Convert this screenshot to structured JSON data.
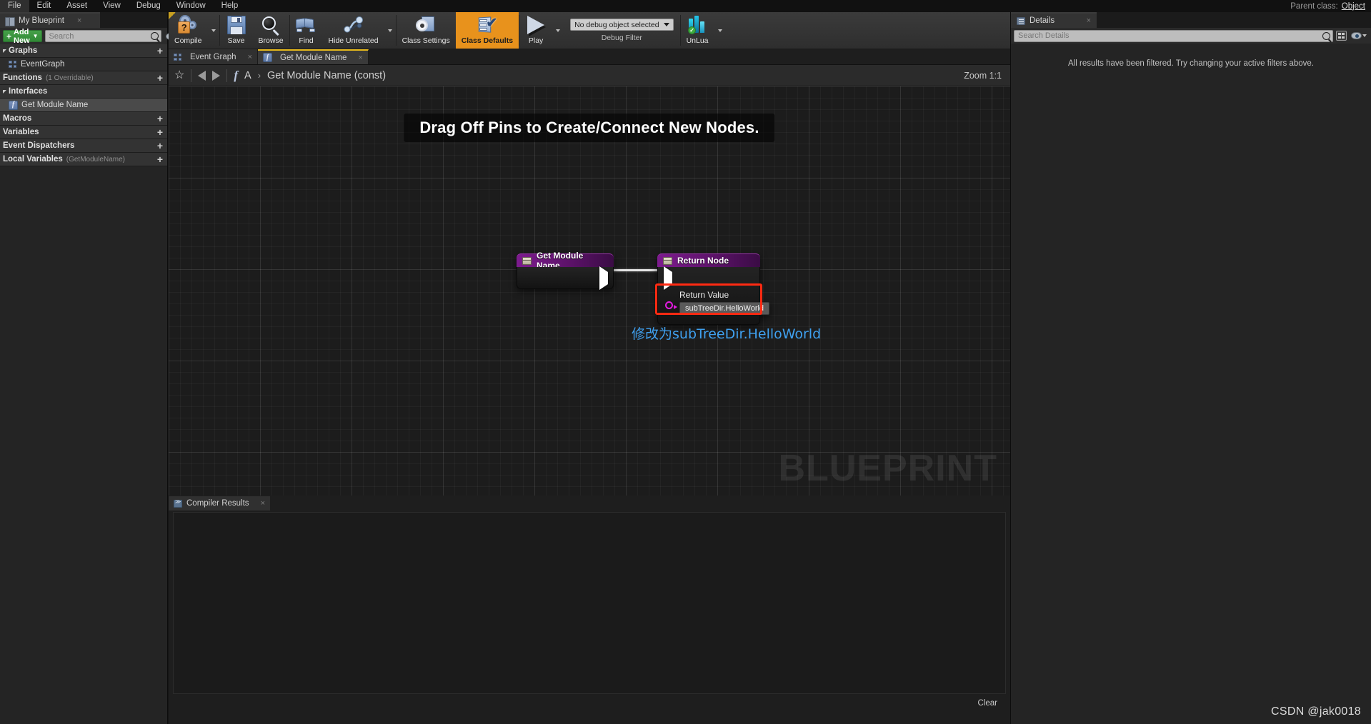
{
  "menubar": {
    "items": [
      "File",
      "Edit",
      "Asset",
      "View",
      "Debug",
      "Window",
      "Help"
    ],
    "parent_class_label": "Parent class:",
    "parent_class_value": "Object"
  },
  "left_panel": {
    "tab_label": "My Blueprint",
    "tab_close": "×",
    "add_new_label": "Add New",
    "add_new_plus": "+",
    "search_placeholder": "Search",
    "search_value": "",
    "tree": [
      {
        "label": "Graphs",
        "sub": "",
        "type": "category",
        "expandable": true,
        "plus": true
      },
      {
        "label": "EventGraph",
        "sub": "",
        "type": "graph-item",
        "expandable": false,
        "plus": false
      },
      {
        "label": "Functions",
        "sub": "(1 Overridable)",
        "type": "category",
        "expandable": false,
        "plus": true
      },
      {
        "label": "Interfaces",
        "sub": "",
        "type": "category",
        "expandable": true,
        "plus": false
      },
      {
        "label": "Get Module Name",
        "sub": "",
        "type": "function-item",
        "expandable": false,
        "plus": false
      },
      {
        "label": "Macros",
        "sub": "",
        "type": "category",
        "expandable": false,
        "plus": true
      },
      {
        "label": "Variables",
        "sub": "",
        "type": "category",
        "expandable": false,
        "plus": true
      },
      {
        "label": "Event Dispatchers",
        "sub": "",
        "type": "category",
        "expandable": false,
        "plus": true
      },
      {
        "label": "Local Variables",
        "sub": "(GetModuleName)",
        "type": "category",
        "expandable": false,
        "plus": true
      }
    ]
  },
  "toolbar": {
    "compile": "Compile",
    "compile_glyph": "?",
    "save": "Save",
    "browse": "Browse",
    "find": "Find",
    "hide_unrelated": "Hide Unrelated",
    "class_settings": "Class Settings",
    "class_defaults": "Class Defaults",
    "class_defaults_active_color": "#e8921c",
    "play": "Play",
    "debug_object": "No debug object selected",
    "debug_filter_label": "Debug Filter",
    "unlua": "UnLua",
    "unlua_check": "✓"
  },
  "graph_tabs": [
    {
      "label": "Event Graph",
      "icon": "event-graph-icon",
      "active": false,
      "close": "×"
    },
    {
      "label": "Get Module Name",
      "icon": "function-icon",
      "active": true,
      "close": "×"
    }
  ],
  "breadcrumb": {
    "star": "☆",
    "function_glyph": "f",
    "root": "A",
    "separator": "›",
    "current": "Get Module Name (const)",
    "zoom": "Zoom 1:1"
  },
  "graph": {
    "hint": "Drag Off Pins to Create/Connect New Nodes.",
    "watermark": "BLUEPRINT",
    "annotation": "修改为subTreeDir.HelloWorld",
    "annotation_color": "#3fa0ef",
    "highlight_color": "#ff2a12",
    "nodes": [
      {
        "title": "Get Module Name",
        "type": "function-entry"
      },
      {
        "title": "Return Node",
        "type": "function-result"
      }
    ],
    "return_pin": {
      "label": "Return Value",
      "value": "subTreeDir.HelloWorld"
    }
  },
  "compiler_results": {
    "tab_label": "Compiler Results",
    "tab_close": "×",
    "clear_label": "Clear",
    "messages": []
  },
  "details_panel": {
    "tab_label": "Details",
    "tab_close": "×",
    "search_placeholder": "Search Details",
    "search_value": "",
    "filtered_message": "All results have been filtered. Try changing your active filters above."
  },
  "watermark": {
    "csdn": "CSDN @jak0018"
  }
}
